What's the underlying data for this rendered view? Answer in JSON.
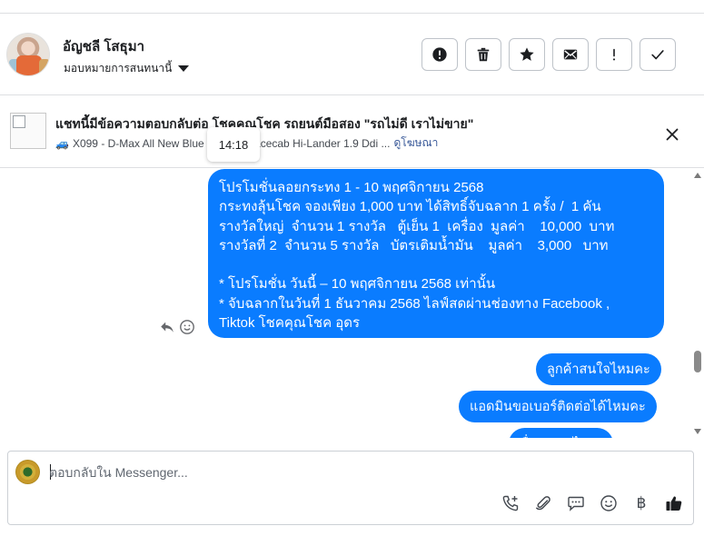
{
  "header": {
    "user_name": "อัญชลี โสธุมา",
    "assign_label": "มอบหมายการสนทนานี้"
  },
  "actions": [
    {
      "name": "mark-spam-button",
      "icon": "alert-circle-icon"
    },
    {
      "name": "delete-button",
      "icon": "trash-icon"
    },
    {
      "name": "star-button",
      "icon": "star-icon"
    },
    {
      "name": "mark-unread-button",
      "icon": "envelope-icon"
    },
    {
      "name": "follow-up-button",
      "icon": "exclamation-icon"
    },
    {
      "name": "mark-done-button",
      "icon": "check-icon"
    }
  ],
  "ad_context": {
    "title": "แชทนี้มีข้อความตอบกลับต่อ โชคคุณโชค รถยนต์มือสอง \"รถไม่ดี เราไม่ขาย\"",
    "car_emoji": "🚙",
    "subtitle": "X099 - D-Max All New Blue Power Spacecab Hi-Lander 1.9 Ddi ...",
    "link": "ดูโฆษณา",
    "tooltip_time": "14:18"
  },
  "messages": [
    {
      "text": "โปรโมชั่นลอยกระทง 1 - 10 พฤศจิกายน 2568\nกระทงลุ้นโชค จองเพียง 1,000 บาท ได้สิทธิ์จับฉลาก 1 ครั้ง /  1 คัน\nรางวัลใหญ่  จำนวน 1 รางวัล   ตู้เย็น 1  เครื่อง  มูลค่า    10,000  บาท\nรางวัลที่ 2  จำนวน 5 รางวัล   บัตรเติมน้ำมัน    มูลค่า    3,000   บาท\n\n* โปรโมชั่น วันนี้ – 10 พฤศจิกายน 2568 เท่านั้น\n* จับฉลากในวันที่ 1 ธันวาคม 2568 ไลฟ์สดผ่านช่องทาง Facebook ,\nTiktok โชคคุณโชค อุดร"
    },
    {
      "text": "ลูกค้าสนใจไหมคะ"
    },
    {
      "text": "แอดมินขอเบอร์ติดต่อได้ไหมคะ"
    },
    {
      "text": "ชื่อเล่นอะไรคะ"
    }
  ],
  "composer": {
    "placeholder": "ตอบกลับใน Messenger...",
    "baht_symbol": "฿"
  },
  "colors": {
    "bubble": "#0a7cff",
    "border": "#dddfe2",
    "link": "#385898"
  }
}
